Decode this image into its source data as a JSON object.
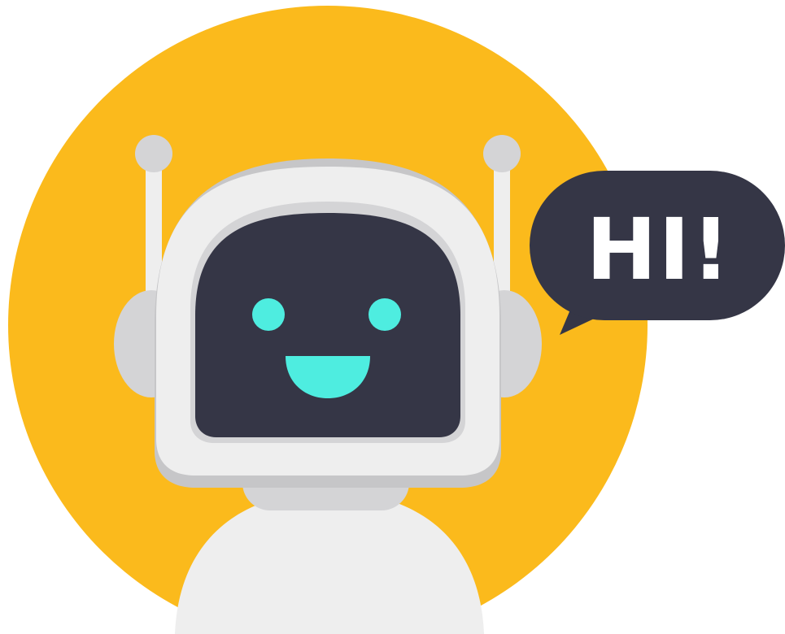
{
  "speech_bubble": {
    "text": "HI!"
  },
  "colors": {
    "background": "#ffffff",
    "circle": "#fbba1c",
    "robot_white": "#eeeeee",
    "robot_shade": "#d4d4d6",
    "robot_shadow": "#c6c6c8",
    "screen": "#353646",
    "face": "#4eede0",
    "bubble": "#353646",
    "bubble_text": "#ffffff"
  }
}
